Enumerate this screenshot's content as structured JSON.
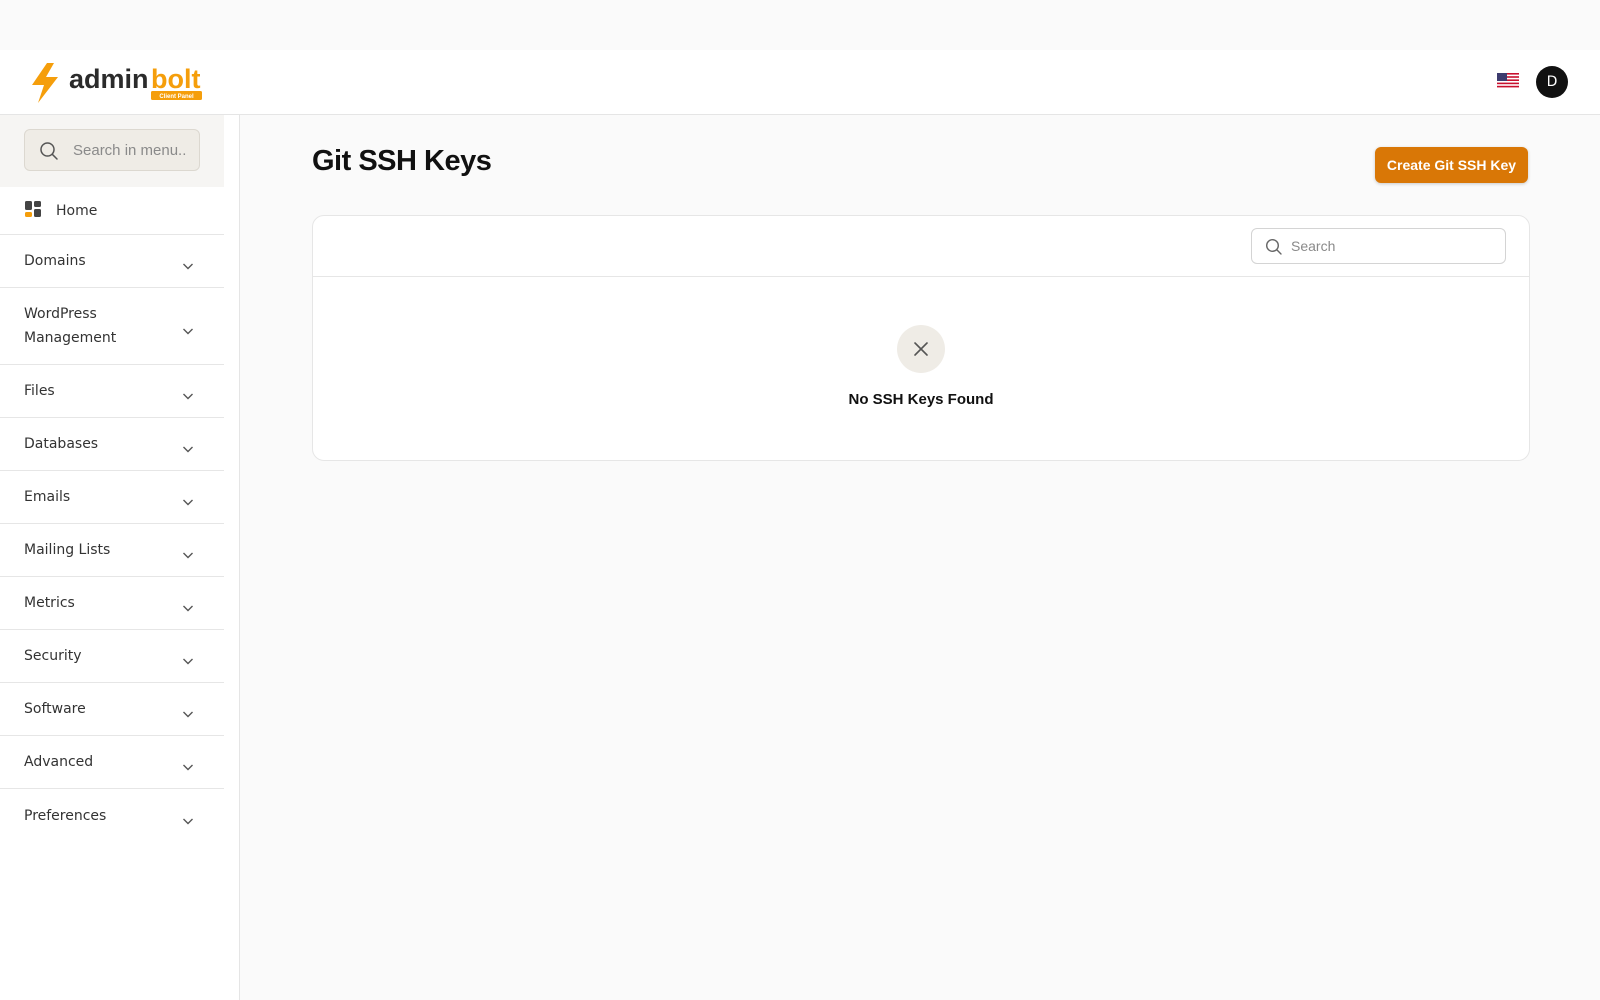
{
  "brand": {
    "name_part1": "admin",
    "name_part2": "bolt",
    "tagline": "Client Panel",
    "accent_color": "#f59e0b",
    "dark_color": "#2b2b2b"
  },
  "header": {
    "language_flag": "us-flag-icon",
    "user_initial": "D"
  },
  "sidebar": {
    "search_placeholder": "Search in menu..",
    "items": [
      {
        "label": "Home",
        "icon": "grid-icon"
      },
      {
        "label": "Domains"
      },
      {
        "label": "WordPress Management"
      },
      {
        "label": "Files"
      },
      {
        "label": "Databases"
      },
      {
        "label": "Emails"
      },
      {
        "label": "Mailing Lists"
      },
      {
        "label": "Metrics"
      },
      {
        "label": "Security"
      },
      {
        "label": "Software"
      },
      {
        "label": "Advanced"
      },
      {
        "label": "Preferences"
      }
    ]
  },
  "main": {
    "title": "Git SSH Keys",
    "create_button_label": "Create Git SSH Key",
    "table_search_placeholder": "Search",
    "empty_state_text": "No SSH Keys Found",
    "button_color": "#d97706"
  }
}
